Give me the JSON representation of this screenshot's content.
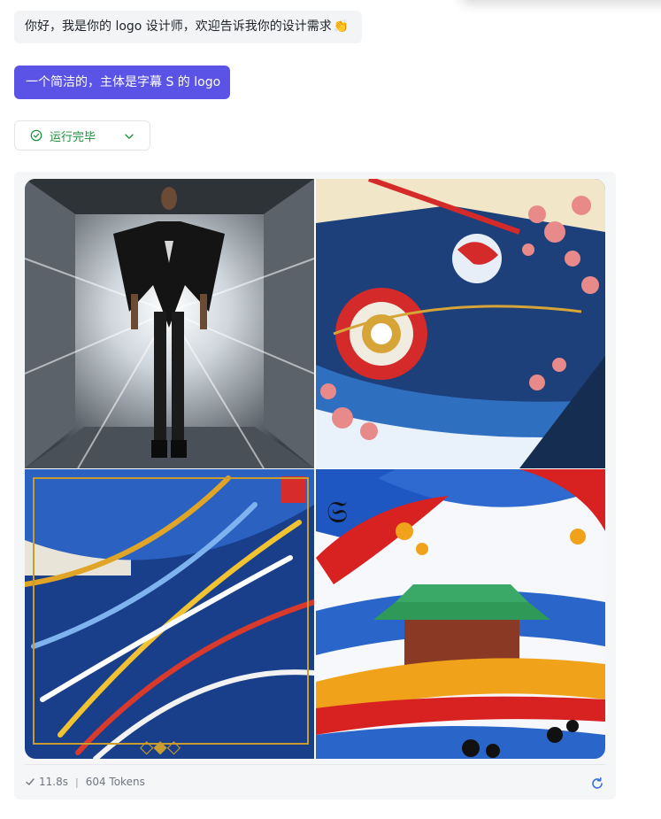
{
  "messages": {
    "assistant_greeting": "你好，我是你的 logo 设计师，欢迎告诉我你的设计需求",
    "greeting_emoji": "👏",
    "user_request": "一个简洁的，主体是字幕 S 的 logo"
  },
  "status": {
    "label": "运行完毕",
    "accent_color": "#1a8f3a"
  },
  "result": {
    "images": [
      {
        "alt": "futuristic fashion figure in black suit"
      },
      {
        "alt": "abstract japanese sun and blossoms"
      },
      {
        "alt": "abstract colorful brush strokes with calligraphy"
      },
      {
        "alt": "japanese temple with colorful waves"
      }
    ],
    "duration": "11.8s",
    "tokens": "604 Tokens"
  },
  "colors": {
    "user_bubble": "#5b53e6",
    "assistant_bubble": "#f3f4f6",
    "card_background": "#f5f6f8"
  }
}
